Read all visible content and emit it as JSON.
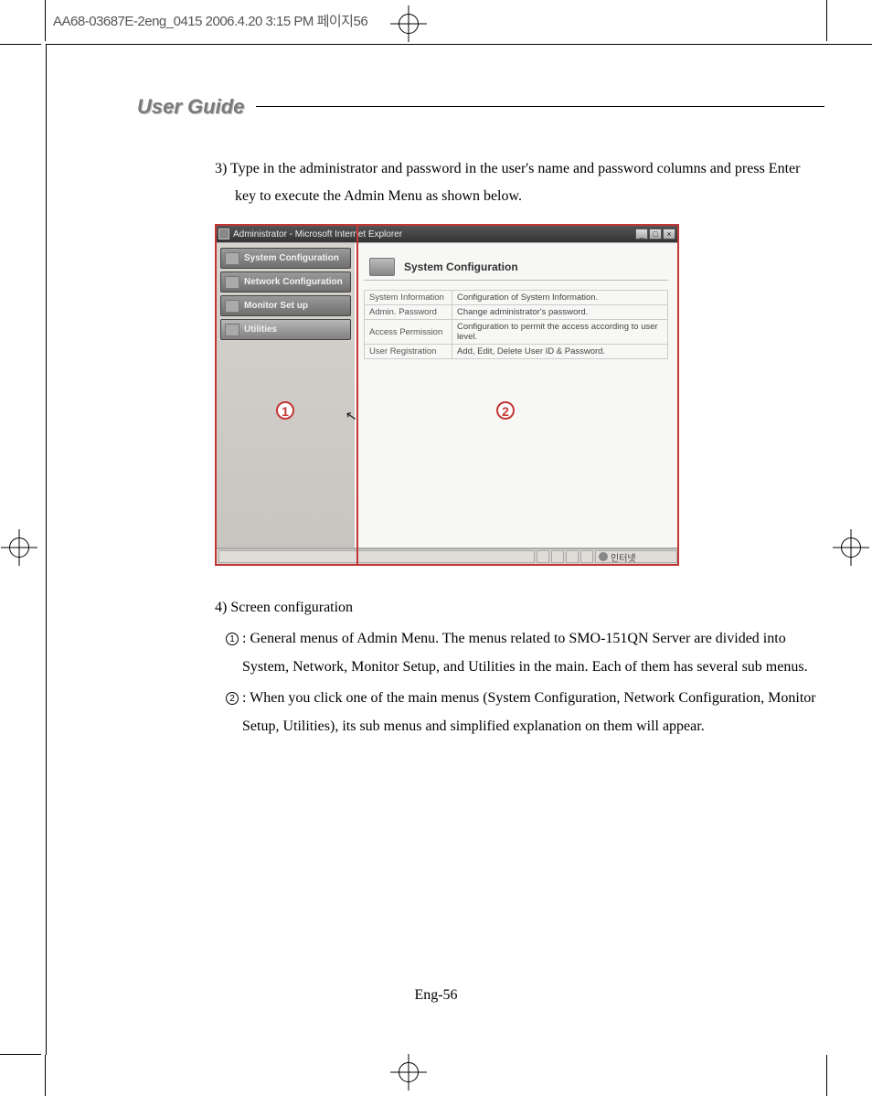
{
  "print_header": "AA68-03687E-2eng_0415  2006.4.20 3:15 PM  페이지56",
  "section_title": "User Guide",
  "step3": "3) Type in the administrator and password in the user's name and password columns and press Enter key to execute the Admin Menu as shown below.",
  "screenshot": {
    "window_title": "Administrator - Microsoft Internet Explorer",
    "win_min": "_",
    "win_max": "□",
    "win_close": "×",
    "sidebar": [
      "System Configuration",
      "Network Configuration",
      "Monitor Set up",
      "Utilities"
    ],
    "panel_title": "System Configuration",
    "table": [
      {
        "k": "System Information",
        "v": "Configuration of System Information."
      },
      {
        "k": "Admin. Password",
        "v": "Change administrator's password."
      },
      {
        "k": "Access Permission",
        "v": "Configuration to permit the access according to user level."
      },
      {
        "k": "User Registration",
        "v": "Add, Edit, Delete User ID & Password."
      }
    ],
    "status_text": "인터넷"
  },
  "callouts": {
    "one": "1",
    "two": "2"
  },
  "step4_heading": "4) Screen configuration",
  "step4_items": [
    {
      "num": "1",
      "text": ": General menus of Admin Menu.  The menus related to SMO-151QN Server are divided into System, Network, Monitor Setup, and Utilities in the main.  Each of them has several sub menus."
    },
    {
      "num": "2",
      "text": ": When you click one of the main menus (System Configuration, Network Configuration, Monitor Setup, Utilities), its sub menus and simplified explanation on them will appear."
    }
  ],
  "page_number": "Eng-56"
}
